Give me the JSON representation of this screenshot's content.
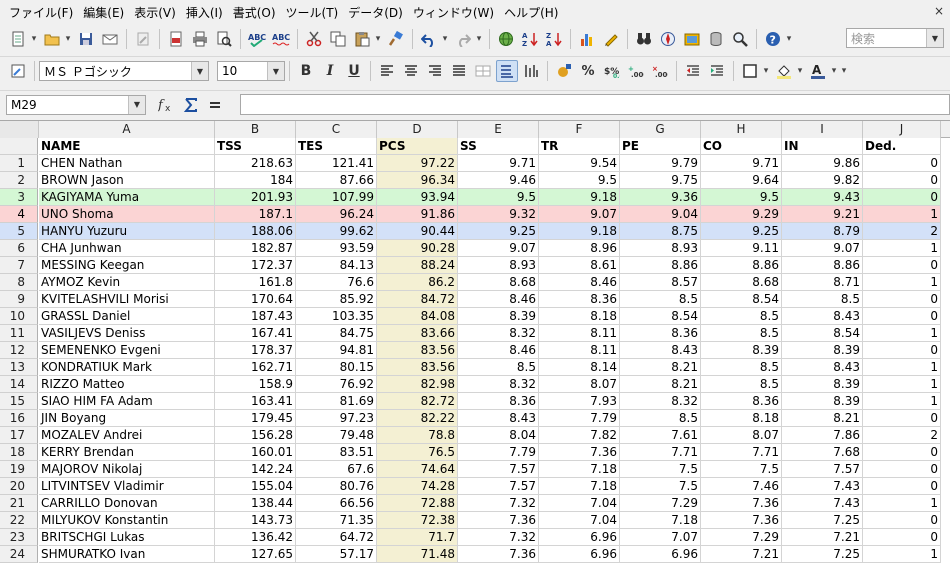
{
  "menubar": {
    "items": [
      "ファイル(F)",
      "編集(E)",
      "表示(V)",
      "挿入(I)",
      "書式(O)",
      "ツール(T)",
      "データ(D)",
      "ウィンドウ(W)",
      "ヘルプ(H)"
    ],
    "close_glyph": "×"
  },
  "toolbar": {
    "search_placeholder": "検索",
    "font_name": "ＭＳ Ｐゴシック",
    "font_size": "10",
    "bold_label": "B",
    "italic_label": "I",
    "underline_label": "U"
  },
  "formulabar": {
    "cell_ref": "M29",
    "formula": ""
  },
  "columns": [
    "A",
    "B",
    "C",
    "D",
    "E",
    "F",
    "G",
    "H",
    "I",
    "J"
  ],
  "header_row": {
    "row_number": "",
    "cells": [
      "NAME",
      "TSS",
      "TES",
      "PCS",
      "SS",
      "TR",
      "PE",
      "CO",
      "IN",
      "Ded."
    ]
  },
  "rows": [
    {
      "n": "1",
      "cells": [
        "CHEN Nathan",
        "218.63",
        "121.41",
        "97.22",
        "9.71",
        "9.54",
        "9.79",
        "9.71",
        "9.86",
        "0"
      ]
    },
    {
      "n": "2",
      "cells": [
        "BROWN Jason",
        "184",
        "87.66",
        "96.34",
        "9.46",
        "9.5",
        "9.75",
        "9.64",
        "9.82",
        "0"
      ]
    },
    {
      "n": "3",
      "cells": [
        "KAGIYAMA Yuma",
        "201.93",
        "107.99",
        "93.94",
        "9.5",
        "9.18",
        "9.36",
        "9.5",
        "9.43",
        "0"
      ],
      "highlight": "green"
    },
    {
      "n": "4",
      "cells": [
        "UNO Shoma",
        "187.1",
        "96.24",
        "91.86",
        "9.32",
        "9.07",
        "9.04",
        "9.29",
        "9.21",
        "1"
      ],
      "highlight": "red"
    },
    {
      "n": "5",
      "cells": [
        "HANYU Yuzuru",
        "188.06",
        "99.62",
        "90.44",
        "9.25",
        "9.18",
        "8.75",
        "9.25",
        "8.79",
        "2"
      ],
      "highlight": "blue"
    },
    {
      "n": "6",
      "cells": [
        "CHA Junhwan",
        "182.87",
        "93.59",
        "90.28",
        "9.07",
        "8.96",
        "8.93",
        "9.11",
        "9.07",
        "1"
      ]
    },
    {
      "n": "7",
      "cells": [
        "MESSING Keegan",
        "172.37",
        "84.13",
        "88.24",
        "8.93",
        "8.61",
        "8.86",
        "8.86",
        "8.86",
        "0"
      ]
    },
    {
      "n": "8",
      "cells": [
        "AYMOZ Kevin",
        "161.8",
        "76.6",
        "86.2",
        "8.68",
        "8.46",
        "8.57",
        "8.68",
        "8.71",
        "1"
      ]
    },
    {
      "n": "9",
      "cells": [
        "KVITELASHVILI Morisi",
        "170.64",
        "85.92",
        "84.72",
        "8.46",
        "8.36",
        "8.5",
        "8.54",
        "8.5",
        "0"
      ]
    },
    {
      "n": "10",
      "cells": [
        "GRASSL Daniel",
        "187.43",
        "103.35",
        "84.08",
        "8.39",
        "8.18",
        "8.54",
        "8.5",
        "8.43",
        "0"
      ]
    },
    {
      "n": "11",
      "cells": [
        "VASILJEVS Deniss",
        "167.41",
        "84.75",
        "83.66",
        "8.32",
        "8.11",
        "8.36",
        "8.5",
        "8.54",
        "1"
      ]
    },
    {
      "n": "12",
      "cells": [
        "SEMENENKO Evgeni",
        "178.37",
        "94.81",
        "83.56",
        "8.46",
        "8.11",
        "8.43",
        "8.39",
        "8.39",
        "0"
      ]
    },
    {
      "n": "13",
      "cells": [
        "KONDRATIUK Mark",
        "162.71",
        "80.15",
        "83.56",
        "8.5",
        "8.14",
        "8.21",
        "8.5",
        "8.43",
        "1"
      ]
    },
    {
      "n": "14",
      "cells": [
        "RIZZO Matteo",
        "158.9",
        "76.92",
        "82.98",
        "8.32",
        "8.07",
        "8.21",
        "8.5",
        "8.39",
        "1"
      ]
    },
    {
      "n": "15",
      "cells": [
        "SIAO HIM FA Adam",
        "163.41",
        "81.69",
        "82.72",
        "8.36",
        "7.93",
        "8.32",
        "8.36",
        "8.39",
        "1"
      ]
    },
    {
      "n": "16",
      "cells": [
        "JIN Boyang",
        "179.45",
        "97.23",
        "82.22",
        "8.43",
        "7.79",
        "8.5",
        "8.18",
        "8.21",
        "0"
      ]
    },
    {
      "n": "17",
      "cells": [
        "MOZALEV Andrei",
        "156.28",
        "79.48",
        "78.8",
        "8.04",
        "7.82",
        "7.61",
        "8.07",
        "7.86",
        "2"
      ]
    },
    {
      "n": "18",
      "cells": [
        "KERRY Brendan",
        "160.01",
        "83.51",
        "76.5",
        "7.79",
        "7.36",
        "7.71",
        "7.71",
        "7.68",
        "0"
      ]
    },
    {
      "n": "19",
      "cells": [
        "MAJOROV Nikolaj",
        "142.24",
        "67.6",
        "74.64",
        "7.57",
        "7.18",
        "7.5",
        "7.5",
        "7.57",
        "0"
      ]
    },
    {
      "n": "20",
      "cells": [
        "LITVINTSEV Vladimir",
        "155.04",
        "80.76",
        "74.28",
        "7.57",
        "7.18",
        "7.5",
        "7.46",
        "7.43",
        "0"
      ]
    },
    {
      "n": "21",
      "cells": [
        "CARRILLO Donovan",
        "138.44",
        "66.56",
        "72.88",
        "7.32",
        "7.04",
        "7.29",
        "7.36",
        "7.43",
        "1"
      ]
    },
    {
      "n": "22",
      "cells": [
        "MILYUKOV Konstantin",
        "143.73",
        "71.35",
        "72.38",
        "7.36",
        "7.04",
        "7.18",
        "7.36",
        "7.25",
        "0"
      ]
    },
    {
      "n": "23",
      "cells": [
        "BRITSCHGI Lukas",
        "136.42",
        "64.72",
        "71.7",
        "7.32",
        "6.96",
        "7.07",
        "7.29",
        "7.21",
        "0"
      ]
    },
    {
      "n": "24",
      "cells": [
        "SHMURATKO Ivan",
        "127.65",
        "57.17",
        "71.48",
        "7.36",
        "6.96",
        "6.96",
        "7.21",
        "7.25",
        "1"
      ]
    }
  ],
  "colors": {
    "pcs_column": "#f4f0d3",
    "highlight_green": "#d4f7d4",
    "highlight_red": "#fbd4d4",
    "highlight_blue": "#d3e1f8"
  }
}
